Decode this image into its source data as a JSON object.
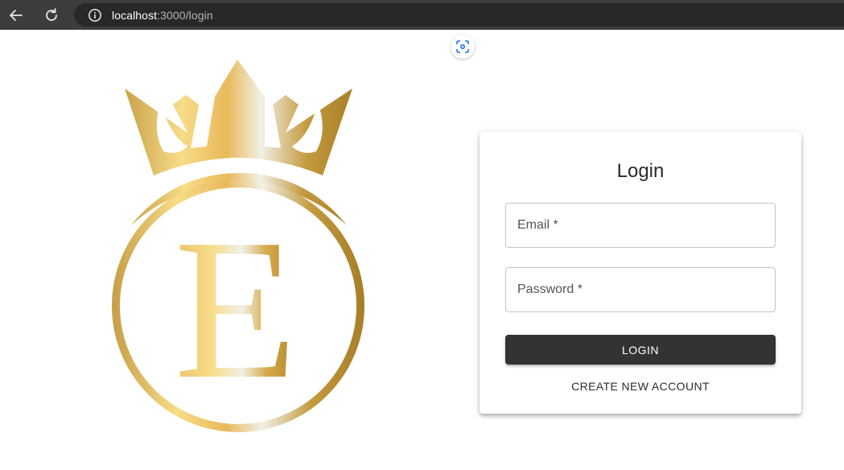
{
  "browser": {
    "url_host": "localhost",
    "url_path": ":3000/login",
    "back_icon": "arrow-left-icon",
    "reload_icon": "reload-icon",
    "info_icon": "info-icon",
    "lens_icon": "lens-icon"
  },
  "logo": {
    "letter": "E",
    "colors": {
      "gold_light": "#f8dc88",
      "gold_mid": "#e8b95a",
      "gold_dark": "#b0862c",
      "highlight": "#f1f0e6"
    }
  },
  "login_card": {
    "title": "Login",
    "email_label": "Email *",
    "password_label": "Password *",
    "login_button": "LOGIN",
    "create_account_link": "CREATE NEW ACCOUNT"
  },
  "colors": {
    "browser_bar": "#3c3c3c",
    "address_bar": "#282828",
    "button_bg": "#333333"
  }
}
